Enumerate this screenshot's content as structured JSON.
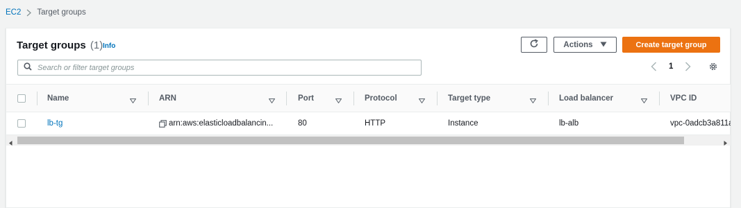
{
  "breadcrumb": {
    "root": "EC2",
    "current": "Target groups"
  },
  "header": {
    "title": "Target groups",
    "count": "(1)",
    "info": "Info"
  },
  "toolbar": {
    "actions_label": "Actions",
    "create_label": "Create target group"
  },
  "search": {
    "placeholder": "Search or filter target groups",
    "value": ""
  },
  "pagination": {
    "current_page": "1"
  },
  "table": {
    "columns": [
      "Name",
      "ARN",
      "Port",
      "Protocol",
      "Target type",
      "Load balancer",
      "VPC ID"
    ],
    "rows": [
      {
        "name": "lb-tg",
        "arn": "arn:aws:elasticloadbalancin...",
        "port": "80",
        "protocol": "HTTP",
        "target_type": "Instance",
        "load_balancer": "lb-alb",
        "vpc_id": "vpc-0adcb3a811a"
      }
    ]
  },
  "icons": {
    "breadcrumb_separator": "chevron-right-icon",
    "refresh": "refresh-icon",
    "actions_caret": "caret-down-icon",
    "search": "search-icon",
    "page_prev": "chevron-left-icon",
    "page_next": "chevron-right-icon",
    "settings": "gear-icon",
    "sort": "sort-caret-icon",
    "copy": "copy-icon"
  },
  "colors": {
    "accent": "#0073bb",
    "primary_button": "#ec7211",
    "background": "#f2f3f3"
  }
}
